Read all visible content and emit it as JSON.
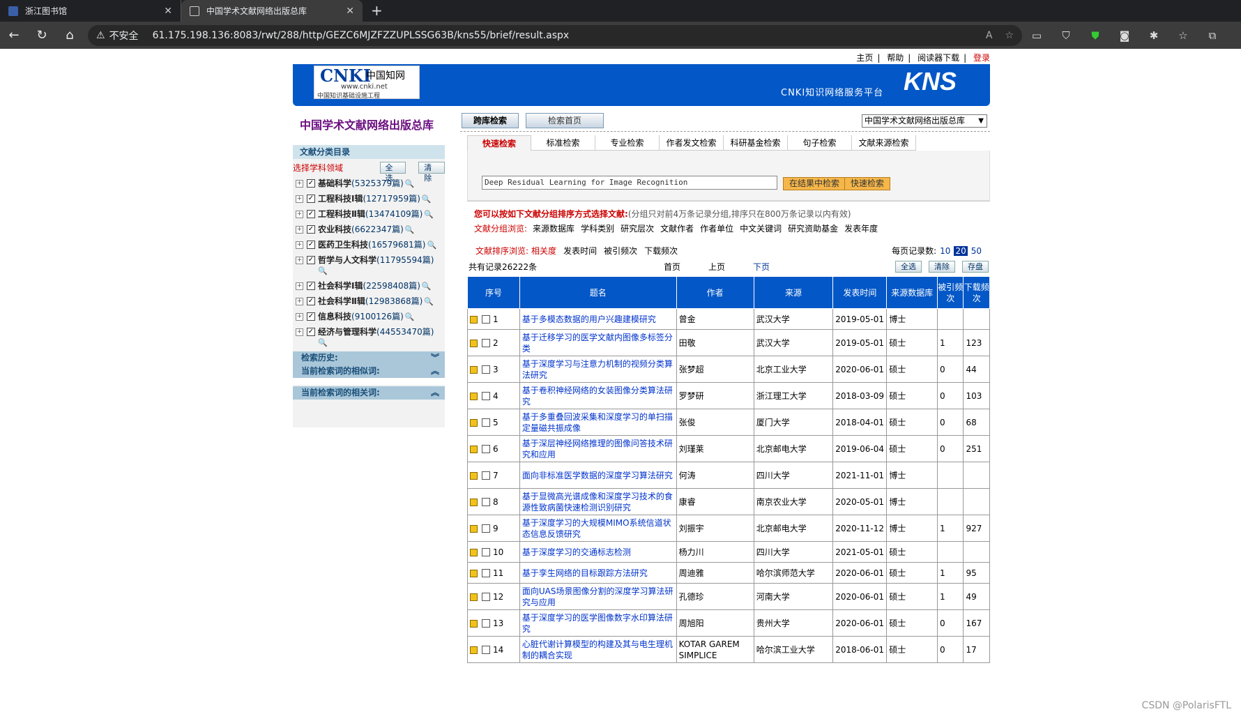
{
  "browser": {
    "tabs": [
      {
        "title": "浙江图书馆",
        "active": false
      },
      {
        "title": "中国学术文献网络出版总库",
        "active": true
      }
    ],
    "security_label": "不安全",
    "url": "61.175.198.136:8083/rwt/288/http/GEZC6MJZFZZUPLSSG63B/kns55/brief/result.aspx"
  },
  "toplinks": [
    "主页",
    "帮助",
    "阅读器下载",
    "登录"
  ],
  "header": {
    "logo_text": "CNKI",
    "logo_cn": "中国知网",
    "logo_url": "www.cnki.net",
    "logo_sub": "中国知识基础设施工程",
    "platform": "CNKI知识网络服务平台",
    "kns": "KNS"
  },
  "db_title": "中国学术文献网络出版总库",
  "top_tabs": [
    "跨库检索",
    "检索首页"
  ],
  "db_select": "中国学术文献网络出版总库",
  "left": {
    "title": "文献分类目录",
    "select_label": "选择学科领域",
    "select_all": "全选",
    "clear": "清除",
    "categories": [
      {
        "name": "基础科学",
        "count": "(5325379篇)"
      },
      {
        "name": "工程科技Ⅰ辑",
        "count": "(12717959篇)"
      },
      {
        "name": "工程科技Ⅱ辑",
        "count": "(13474109篇)"
      },
      {
        "name": "农业科技",
        "count": "(6622347篇)"
      },
      {
        "name": "医药卫生科技",
        "count": "(16579681篇)"
      },
      {
        "name": "哲学与人文科学",
        "count": "(11795594篇)"
      },
      {
        "name": "社会科学Ⅰ辑",
        "count": "(22598408篇)"
      },
      {
        "name": "社会科学Ⅱ辑",
        "count": "(12983868篇)"
      },
      {
        "name": "信息科技",
        "count": "(9100126篇)"
      },
      {
        "name": "经济与管理科学",
        "count": "(44553470篇)"
      }
    ],
    "history": "检索历史:",
    "similar": "当前检索词的相似词:",
    "related": "当前检索词的相关词:"
  },
  "search_tabs": [
    "快速检索",
    "标准检索",
    "专业检索",
    "作者发文检索",
    "科研基金检索",
    "句子检索",
    "文献来源检索"
  ],
  "query": "Deep Residual Learning for Image Recognition",
  "btn_in_result": "在结果中检索",
  "btn_quick": "快速检索",
  "group": {
    "tip_main": "您可以按如下文献分组排序方式选择文献:",
    "tip_note": "(分组只对前4万条记录分组,排序只在800万条记录以内有效)",
    "browse_label": "文献分组浏览:",
    "items": [
      "来源数据库",
      "学科类别",
      "研究层次",
      "文献作者",
      "作者单位",
      "中文关键词",
      "研究资助基金",
      "发表年度"
    ]
  },
  "sort": {
    "label": "文献排序浏览:",
    "items": [
      "相关度",
      "发表时间",
      "被引频次",
      "下载频次"
    ],
    "page_label": "每页记录数:",
    "sizes": [
      "10",
      "20",
      "50"
    ]
  },
  "pager": {
    "total": "共有记录26222条",
    "first": "首页",
    "prev": "上页",
    "next": "下页",
    "buttons": [
      "全选",
      "清除",
      "存盘"
    ]
  },
  "table": {
    "headers": [
      "序号",
      "题名",
      "作者",
      "来源",
      "发表时间",
      "来源数据库",
      "被引频次",
      "下载频次"
    ],
    "rows": [
      {
        "no": "1",
        "title": "基于多模态数据的用户兴趣建模研究",
        "author": "曾金",
        "source": "武汉大学",
        "date": "2019-05-01",
        "db": "博士",
        "cite": "",
        "dl": ""
      },
      {
        "no": "2",
        "title": "基于迁移学习的医学文献内图像多标签分类",
        "author": "田敬",
        "source": "武汉大学",
        "date": "2019-05-01",
        "db": "硕士",
        "cite": "1",
        "dl": "123"
      },
      {
        "no": "3",
        "title": "基于深度学习与注意力机制的视频分类算法研究",
        "author": "张梦超",
        "source": "北京工业大学",
        "date": "2020-06-01",
        "db": "硕士",
        "cite": "0",
        "dl": "44"
      },
      {
        "no": "4",
        "title": "基于卷积神经网络的女装图像分类算法研究",
        "author": "罗梦研",
        "source": "浙江理工大学",
        "date": "2018-03-09",
        "db": "硕士",
        "cite": "0",
        "dl": "103"
      },
      {
        "no": "5",
        "title": "基于多重叠回波采集和深度学习的单扫描定量磁共振成像",
        "author": "张俊",
        "source": "厦门大学",
        "date": "2018-04-01",
        "db": "硕士",
        "cite": "0",
        "dl": "68"
      },
      {
        "no": "6",
        "title": "基于深层神经网络推理的图像问答技术研究和应用",
        "author": "刘瑾莱",
        "source": "北京邮电大学",
        "date": "2019-06-04",
        "db": "硕士",
        "cite": "0",
        "dl": "251"
      },
      {
        "no": "7",
        "title": "面向非标准医学数据的深度学习算法研究",
        "author": "何涛",
        "source": "四川大学",
        "date": "2021-11-01",
        "db": "博士",
        "cite": "",
        "dl": ""
      },
      {
        "no": "8",
        "title": "基于显微高光谱成像和深度学习技术的食源性致病菌快速检测识别研究",
        "author": "康睿",
        "source": "南京农业大学",
        "date": "2020-05-01",
        "db": "博士",
        "cite": "",
        "dl": ""
      },
      {
        "no": "9",
        "title": "基于深度学习的大规模MIMO系统信道状态信息反馈研究",
        "author": "刘振宇",
        "source": "北京邮电大学",
        "date": "2020-11-12",
        "db": "博士",
        "cite": "1",
        "dl": "927"
      },
      {
        "no": "10",
        "title": "基于深度学习的交通标志检测",
        "author": "杨力川",
        "source": "四川大学",
        "date": "2021-05-01",
        "db": "硕士",
        "cite": "",
        "dl": ""
      },
      {
        "no": "11",
        "title": "基于孪生网络的目标跟踪方法研究",
        "author": "周迪雅",
        "source": "哈尔滨师范大学",
        "date": "2020-06-01",
        "db": "硕士",
        "cite": "1",
        "dl": "95"
      },
      {
        "no": "12",
        "title": "面向UAS场景图像分割的深度学习算法研究与应用",
        "author": "孔德珍",
        "source": "河南大学",
        "date": "2020-06-01",
        "db": "硕士",
        "cite": "1",
        "dl": "49"
      },
      {
        "no": "13",
        "title": "基于深度学习的医学图像数字水印算法研究",
        "author": "周旭阳",
        "source": "贵州大学",
        "date": "2020-06-01",
        "db": "硕士",
        "cite": "0",
        "dl": "167"
      },
      {
        "no": "14",
        "title": "心脏代谢计算模型的构建及其与电生理机制的耦合实现",
        "author": "KOTAR GAREM SIMPLICE",
        "source": "哈尔滨工业大学",
        "date": "2018-06-01",
        "db": "硕士",
        "cite": "0",
        "dl": "17"
      }
    ]
  },
  "watermark": "CSDN @PolarisFTL"
}
